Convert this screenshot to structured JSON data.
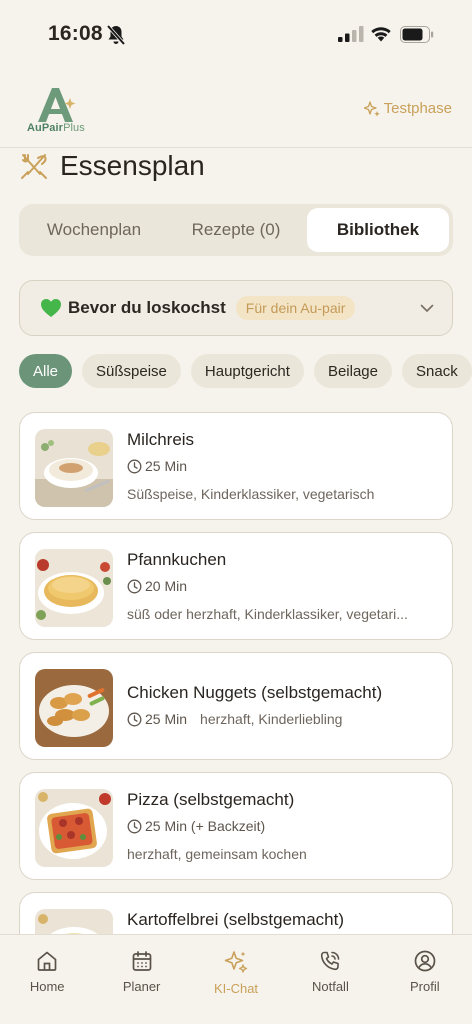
{
  "status_bar": {
    "time": "16:08"
  },
  "header": {
    "logo_brand": "AuPair",
    "logo_suffix": "Plus",
    "trial_label": "Testphase"
  },
  "page": {
    "title": "Essensplan"
  },
  "tabs": [
    {
      "label": "Wochenplan",
      "active": false
    },
    {
      "label": "Rezepte (0)",
      "active": false
    },
    {
      "label": "Bibliothek",
      "active": true
    }
  ],
  "tip": {
    "title": "Bevor du loskochst",
    "badge": "Für dein Au-pair"
  },
  "filters": [
    {
      "label": "Alle",
      "active": true
    },
    {
      "label": "Süßspeise",
      "active": false
    },
    {
      "label": "Hauptgericht",
      "active": false
    },
    {
      "label": "Beilage",
      "active": false
    },
    {
      "label": "Snack",
      "active": false
    }
  ],
  "recipes": [
    {
      "name": "Milchreis",
      "time": "25 Min",
      "tags": "Süßspeise, Kinderklassiker, vegetarisch"
    },
    {
      "name": "Pfannkuchen",
      "time": "20 Min",
      "tags": "süß oder herzhaft, Kinderklassiker, vegetari..."
    },
    {
      "name": "Chicken Nuggets (selbstgemacht)",
      "time": "25 Min",
      "tags": "herzhaft, Kinderliebling"
    },
    {
      "name": "Pizza (selbstgemacht)",
      "time": "25 Min (+ Backzeit)",
      "tags": "herzhaft, gemeinsam kochen"
    },
    {
      "name": "Kartoffelbrei (selbstgemacht)",
      "time": "",
      "tags": ""
    }
  ],
  "bottom_nav": [
    {
      "label": "Home",
      "icon": "home-icon",
      "active": false
    },
    {
      "label": "Planer",
      "icon": "calendar-icon",
      "active": false
    },
    {
      "label": "KI-Chat",
      "icon": "sparkle-icon",
      "active": true
    },
    {
      "label": "Notfall",
      "icon": "phone-icon",
      "active": false
    },
    {
      "label": "Profil",
      "icon": "profile-icon",
      "active": false
    }
  ],
  "colors": {
    "background": "#f6f3ec",
    "accent_green": "#6b9478",
    "accent_gold": "#c9a15a",
    "card": "#ffffff"
  }
}
